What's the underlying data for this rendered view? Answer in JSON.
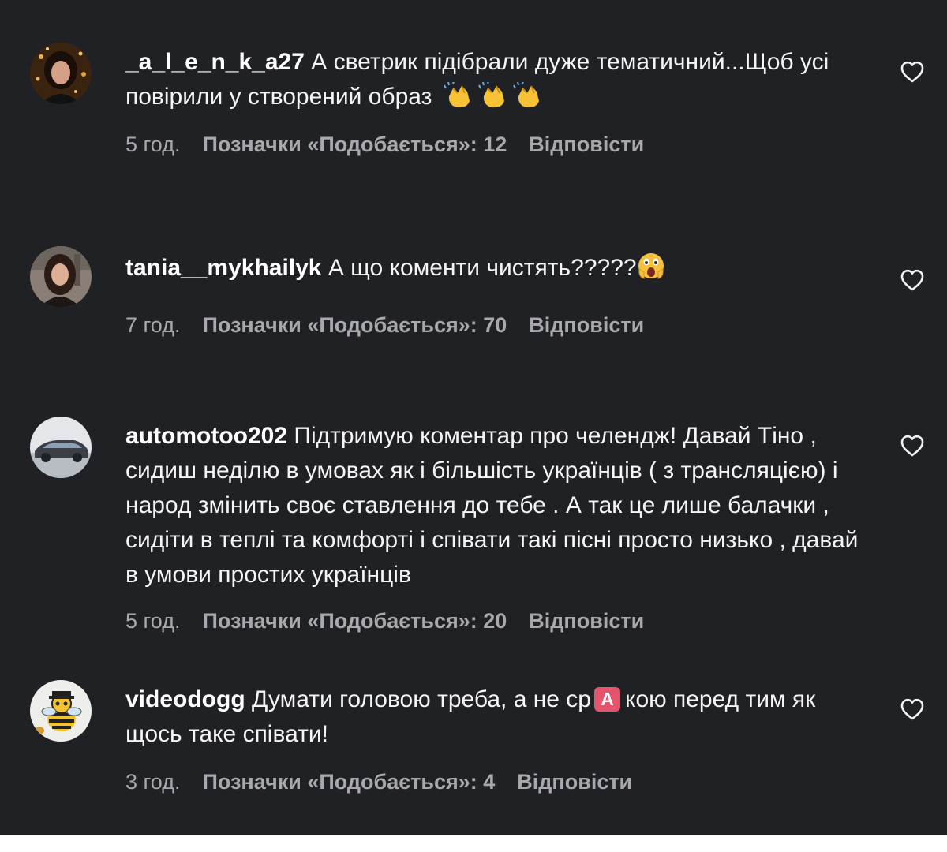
{
  "comments": [
    {
      "username": "_a_l_e_n_k_a27",
      "text_before": "А светрик підібрали дуже тематичний...Щоб усі повірили у створений образ",
      "emoji": [
        "clapping-hands-emoji",
        "clapping-hands-emoji",
        "clapping-hands-emoji"
      ],
      "time": "5 год.",
      "likes": "Позначки «Подобається»: 12",
      "reply": "Відповісти"
    },
    {
      "username": "tania__mykhailyk",
      "text_before": "А що коменти чистять?????",
      "emoji": [
        "astonished-face-emoji"
      ],
      "time": "7 год.",
      "likes": "Позначки «Подобається»: 70",
      "reply": "Відповісти"
    },
    {
      "username": "automotoo202",
      "text_before": "Підтримую коментар про челендж! Давай Тіно , сидиш неділю в умовах як і більшість українців ( з трансляцією) і народ змінить своє ставлення до тебе . А так це лише балачки , сидіти в теплі та комфорті і співати такі пісні просто низько , давай в умови простих українців",
      "time": "5 год.",
      "likes": "Позначки «Подобається»: 20",
      "reply": "Відповісти"
    },
    {
      "username": "videodogg",
      "text_before": "Думати головою треба, а не ср",
      "inline_badge": "A",
      "text_after": "кою перед тим як щось таке співати!",
      "time": "3 год.",
      "likes": "Позначки «Подобається»: 4",
      "reply": "Відповісти"
    }
  ],
  "icons": {
    "like": "heart-outline-icon"
  },
  "colors": {
    "background": "#202125",
    "text": "#f5f5f5",
    "meta": "#a8a8ad",
    "badge": "#e5546d"
  }
}
